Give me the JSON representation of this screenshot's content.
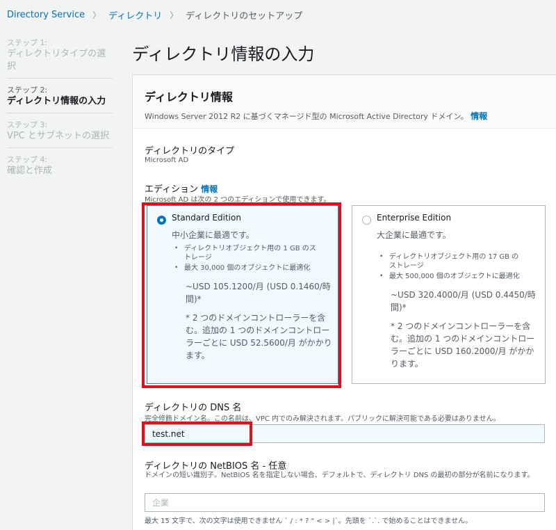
{
  "breadcrumb": {
    "item1": "Directory Service",
    "item2": "ディレクトリ",
    "current": "ディレクトリのセットアップ"
  },
  "steps": [
    {
      "num": "ステップ 1:",
      "label": "ディレクトリタイプの選択"
    },
    {
      "num": "ステップ 2:",
      "label": "ディレクトリ情報の入力"
    },
    {
      "num": "ステップ 3:",
      "label": "VPC とサブネットの選択"
    },
    {
      "num": "ステップ 4:",
      "label": "確認と作成"
    }
  ],
  "page_title": "ディレクトリ情報の入力",
  "panel": {
    "title": "ディレクトリ情報",
    "desc": "Windows Server 2012 R2 に基づくマネージド型の Microsoft Active Directory ドメイン。",
    "info": "情報"
  },
  "directory_type": {
    "label": "ディレクトリのタイプ",
    "value": "Microsoft AD"
  },
  "edition": {
    "label": "エディション",
    "info": "情報",
    "desc": "Microsoft AD は次の 2 つのエディションで使用できます。",
    "standard": {
      "title": "Standard Edition",
      "subtitle": "中小企業に最適です。",
      "bullet1": "ディレクトリオブジェクト用の 1 GB のストレージ",
      "bullet2": "最大 30,000 個のオブジェクトに最適化",
      "price": "~USD 105.1200/月 (USD 0.1460/時間)*",
      "note": "* 2 つのドメインコントローラーを含む。追加の 1 つのドメインコントローラーごとに USD 52.5600/月 がかかります。"
    },
    "enterprise": {
      "title": "Enterprise Edition",
      "subtitle": "大企業に最適です。",
      "bullet1": "ディレクトリオブジェクト用の 17 GB のストレージ",
      "bullet2": "最大 500,000 個のオブジェクトに最適化",
      "price": "~USD 320.4000/月 (USD 0.4450/時間)*",
      "note": "* 2 つのドメインコントローラーを含む。追加の 1 つのドメインコントローラーごとに USD 160.2000/月 がかかります。"
    }
  },
  "dns": {
    "label": "ディレクトリの DNS 名",
    "desc": "完全修飾ドメイン名。この名前は、VPC 内でのみ解決されます。パブリックに解決可能である必要はありません。",
    "value": "test.net"
  },
  "netbios": {
    "label": "ディレクトリの NetBIOS 名 - 任意",
    "desc": "ドメインの短い識別子。NetBIOS 名を指定しない場合、デフォルトで、ディレクトリ DNS の最初の部分が名前になります。",
    "placeholder": "企業",
    "hint": "最大 15 文字で、次の文字は使用できません ` / : * ? \" < > |`。先頭を `.`. で始めることはできません。"
  },
  "colors": {
    "link": "#0073bb",
    "selected_bg": "#f1faff",
    "highlight": "#e0101a"
  }
}
